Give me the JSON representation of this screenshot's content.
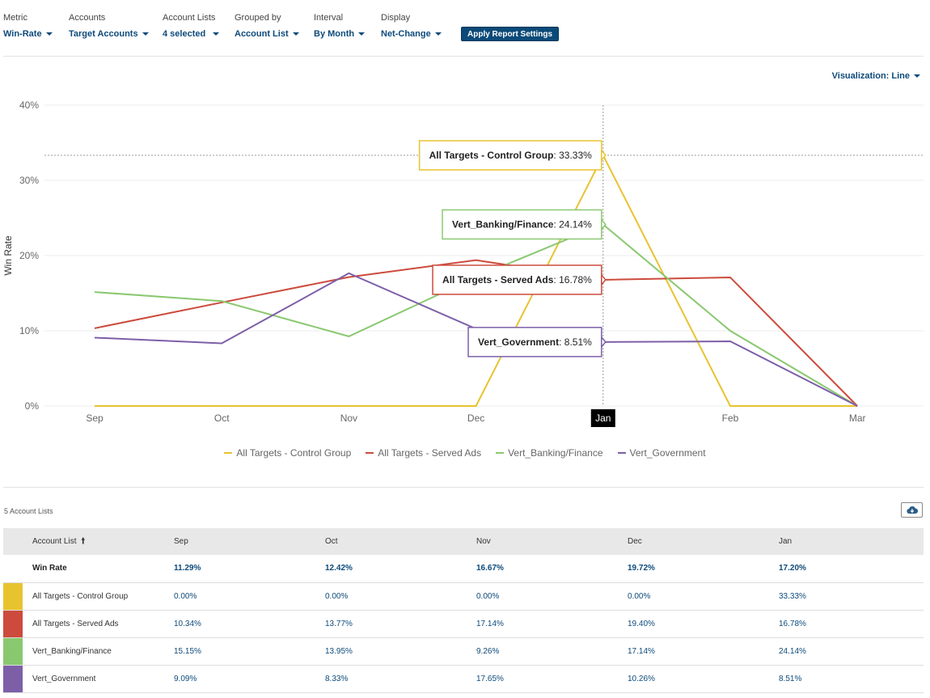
{
  "filters": [
    {
      "label": "Metric",
      "value": "Win-Rate"
    },
    {
      "label": "Accounts",
      "value": "Target Accounts"
    },
    {
      "label": "Account Lists",
      "value": "4 selected"
    },
    {
      "label": "Grouped by",
      "value": "Account List"
    },
    {
      "label": "Interval",
      "value": "By Month"
    },
    {
      "label": "Display",
      "value": "Net-Change"
    }
  ],
  "apply_label": "Apply Report Settings",
  "visualization_label": "Visualization: Line",
  "chart_data": {
    "type": "line",
    "ylabel": "Win Rate",
    "categories": [
      "Sep",
      "Oct",
      "Nov",
      "Dec",
      "Jan",
      "Feb",
      "Mar"
    ],
    "y_ticks": [
      "0%",
      "10%",
      "20%",
      "30%",
      "40%"
    ],
    "ylim": [
      0,
      40
    ],
    "grid": true,
    "legend_position": "bottom",
    "hover_category": "Jan",
    "series": [
      {
        "name": "All Targets - Control Group",
        "color": "#e8c330",
        "values": [
          0,
          0,
          0,
          0,
          33.33,
          0,
          0
        ],
        "tooltip": "33.33%"
      },
      {
        "name": "All Targets - Served Ads",
        "color": "#cc4b3c",
        "values": [
          10.34,
          13.77,
          17.14,
          19.4,
          16.78,
          17.1,
          0
        ],
        "tooltip": "16.78%"
      },
      {
        "name": "Vert_Banking/Finance",
        "color": "#8ac870",
        "values": [
          15.15,
          13.95,
          9.26,
          17.14,
          24.14,
          10.0,
          0
        ],
        "tooltip": "24.14%"
      },
      {
        "name": "Vert_Government",
        "color": "#7d5fa8",
        "values": [
          9.09,
          8.33,
          17.65,
          10.26,
          8.51,
          8.6,
          0
        ],
        "tooltip": "8.51%"
      }
    ]
  },
  "table": {
    "count_label": "5 Account Lists",
    "headers": [
      "Account List",
      "Sep",
      "Oct",
      "Nov",
      "Dec",
      "Jan"
    ],
    "total_row": {
      "name": "Win Rate",
      "values": [
        "11.29%",
        "12.42%",
        "16.67%",
        "19.72%",
        "17.20%"
      ]
    },
    "rows": [
      {
        "name": "All Targets - Control Group",
        "color": "#e8c330",
        "values": [
          "0.00%",
          "0.00%",
          "0.00%",
          "0.00%",
          "33.33%"
        ]
      },
      {
        "name": "All Targets - Served Ads",
        "color": "#cc4b3c",
        "values": [
          "10.34%",
          "13.77%",
          "17.14%",
          "19.40%",
          "16.78%"
        ]
      },
      {
        "name": "Vert_Banking/Finance",
        "color": "#8ac870",
        "values": [
          "15.15%",
          "13.95%",
          "9.26%",
          "17.14%",
          "24.14%"
        ]
      },
      {
        "name": "Vert_Government",
        "color": "#7d5fa8",
        "values": [
          "9.09%",
          "8.33%",
          "17.65%",
          "10.26%",
          "8.51%"
        ]
      }
    ]
  }
}
